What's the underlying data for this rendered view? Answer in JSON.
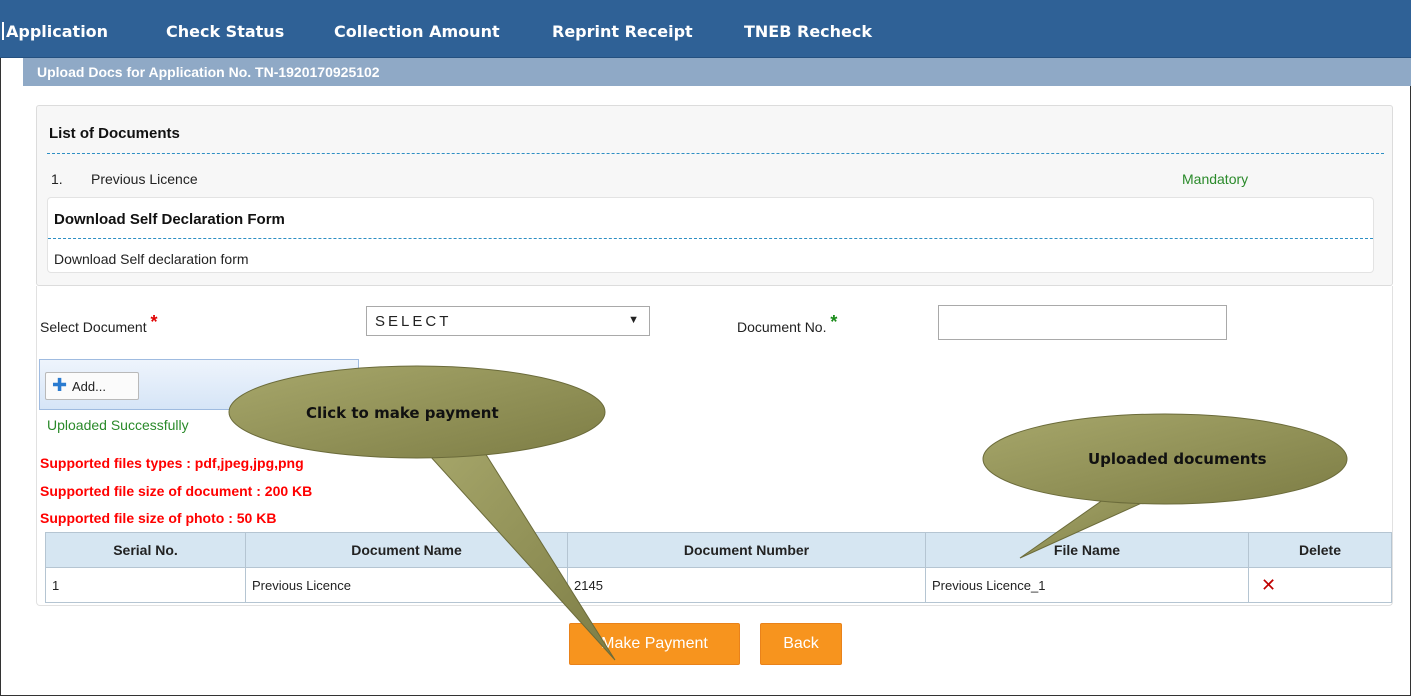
{
  "nav": {
    "items": [
      "Application",
      "Check Status",
      "Collection Amount",
      "Reprint Receipt",
      "TNEB Recheck"
    ]
  },
  "title_bar": "Upload Docs for Application No. TN-1920170925102",
  "documents": {
    "heading": "List of Documents",
    "items": [
      {
        "number": "1.",
        "name": "Previous Licence",
        "status": "Mandatory"
      }
    ]
  },
  "declaration": {
    "heading": "Download Self Declaration Form",
    "link": "Download Self declaration form"
  },
  "form": {
    "select_label": "Select Document",
    "select_value": "SELECT",
    "docno_label": "Document No.",
    "required_mark": "*",
    "docno_value": ""
  },
  "upload": {
    "add_label": "Add...",
    "success": "Uploaded Successfully"
  },
  "notes": [
    "Supported files types : pdf,jpeg,jpg,png",
    "Supported file size of document : 200 KB",
    "Supported file size of photo : 50 KB"
  ],
  "table": {
    "headers": [
      "Serial No.",
      "Document Name",
      "Document Number",
      "File Name",
      "Delete"
    ],
    "rows": [
      {
        "serial": "1",
        "name": "Previous Licence",
        "number": "2145",
        "file": "Previous Licence_1",
        "delete": "✕"
      }
    ]
  },
  "buttons": {
    "make_payment": "Make Payment",
    "back": "Back"
  },
  "callouts": {
    "payment": "Click to make payment",
    "uploaded": "Uploaded documents"
  },
  "colors": {
    "nav": "#2f6196",
    "title_bar": "#8fa9c6",
    "mandatory": "#2a8a2a",
    "note": "#ff0000",
    "button": "#f7941e",
    "callout": "#9a9a5c"
  }
}
